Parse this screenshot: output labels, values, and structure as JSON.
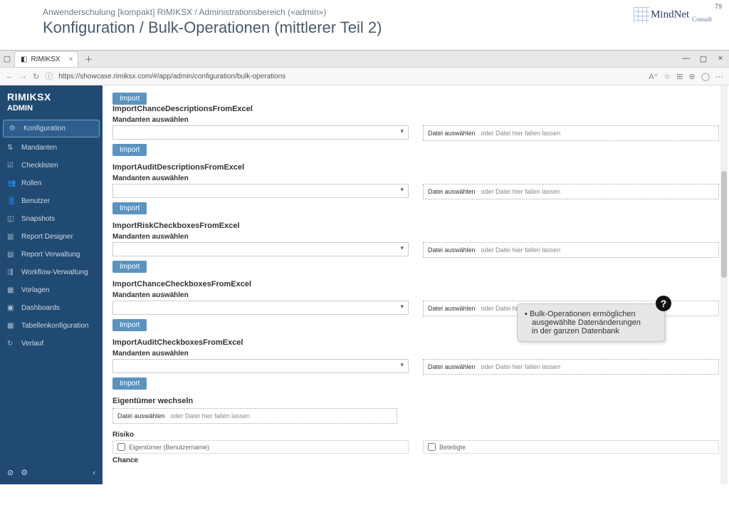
{
  "slide": {
    "page_no": "79",
    "logo_text": "MindNet",
    "logo_suffix": "Consult",
    "breadcrumb": "Anwenderschulung [kompakt] RIMIKSX / Administrationsbereich («admin»)",
    "title": "Konfiguration / Bulk-Operationen (mittlerer Teil 2)"
  },
  "browser": {
    "tab_title": "RIMIKSX",
    "url": "https://showcase.rimiksx.com/#/app/admin/configuration/bulk-operations"
  },
  "app": {
    "brand": "RIMIKSX",
    "admin_label": "ADMIN",
    "nav": [
      {
        "label": "Konfiguration",
        "icon": "⚙",
        "active": true
      },
      {
        "label": "Mandanten",
        "icon": "⇅"
      },
      {
        "label": "Checklisten",
        "icon": "☑"
      },
      {
        "label": "Rollen",
        "icon": "👥"
      },
      {
        "label": "Benutzer",
        "icon": "👤"
      },
      {
        "label": "Snapshots",
        "icon": "◫"
      },
      {
        "label": "Report Designer",
        "icon": "▥"
      },
      {
        "label": "Report Verwaltung",
        "icon": "▤"
      },
      {
        "label": "Workflow-Verwaltung",
        "icon": "⇶"
      },
      {
        "label": "Vorlagen",
        "icon": "▦"
      },
      {
        "label": "Dashboards",
        "icon": "▣"
      },
      {
        "label": "Tabellenkonfiguration",
        "icon": "▦"
      },
      {
        "label": "Verlauf",
        "icon": "↻"
      }
    ],
    "bottom_icons": [
      "⊘",
      "⚙",
      "‹"
    ]
  },
  "labels": {
    "mandant": "Mandanten auswählen",
    "import": "Import",
    "file_btn": "Datei auswählen",
    "file_hint": "oder Datei hier fallen lassen"
  },
  "ops": [
    {
      "title": "ImportChanceDescriptionsFromExcel"
    },
    {
      "title": "ImportAuditDescriptionsFromExcel"
    },
    {
      "title": "ImportRiskCheckboxesFromExcel"
    },
    {
      "title": "ImportChanceCheckboxesFromExcel"
    },
    {
      "title": "ImportAuditCheckboxesFromExcel"
    }
  ],
  "owner": {
    "title": "Eigentümer wechseln",
    "risk_label": "Risiko",
    "risk_cb": "Eigentümer (Benutzername)",
    "chance_label": "Chance",
    "right_cb": "Beteiligte"
  },
  "tooltip": {
    "line1": "Bulk-Operationen ermöglichen",
    "line2": "ausgewählte Datenänderungen",
    "line3": "in der ganzen Datenbank"
  }
}
